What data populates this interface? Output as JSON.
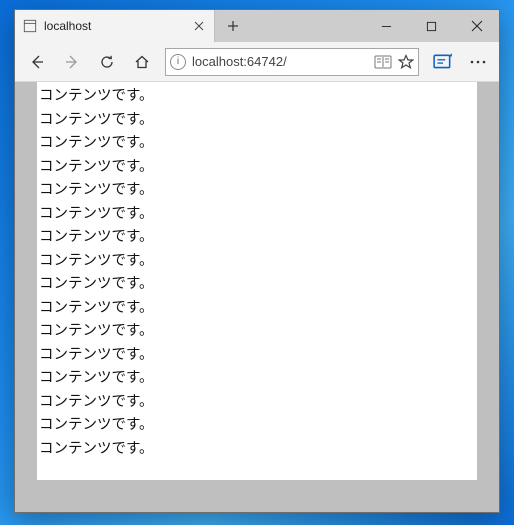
{
  "tab": {
    "title": "localhost"
  },
  "addressbar": {
    "url": "localhost:64742/"
  },
  "content": {
    "line": "コンテンツです。",
    "repeat": 16
  }
}
